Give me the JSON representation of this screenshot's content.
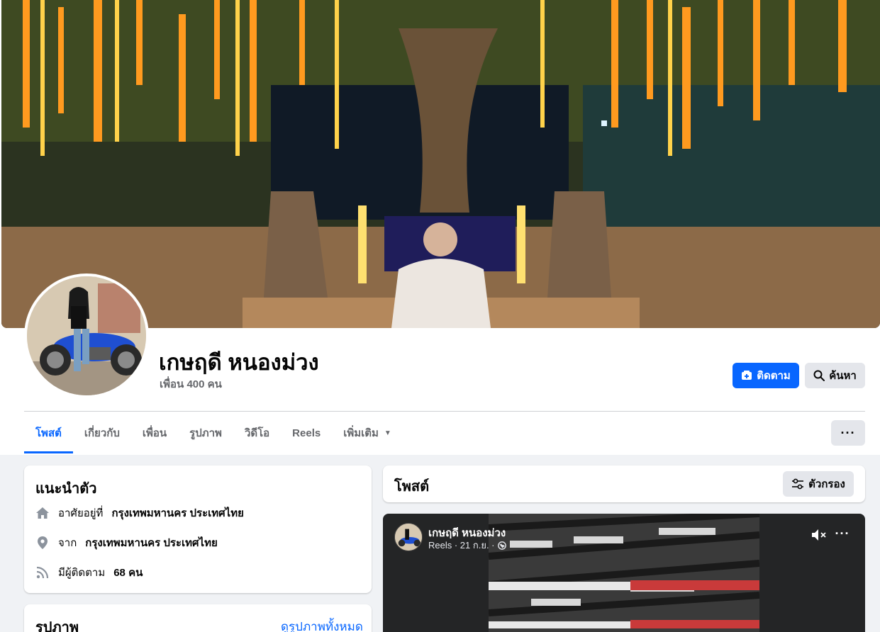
{
  "profile": {
    "name": "เกษฤดี หนองม่วง",
    "friends": "เพื่อน 400 คน"
  },
  "actions": {
    "follow_label": "ติดตาม",
    "search_label": "ค้นหา",
    "more_label": "···"
  },
  "tabs": [
    {
      "label": "โพสต์",
      "active": true
    },
    {
      "label": "เกี่ยวกับ",
      "active": false
    },
    {
      "label": "เพื่อน",
      "active": false
    },
    {
      "label": "รูปภาพ",
      "active": false
    },
    {
      "label": "วิดีโอ",
      "active": false
    },
    {
      "label": "Reels",
      "active": false
    },
    {
      "label": "เพิ่มเติม",
      "active": false
    }
  ],
  "intro": {
    "title": "แนะนำตัว",
    "lives_prefix": "อาศัยอยู่ที่",
    "lives_place": "กรุงเทพมหานคร ประเทศไทย",
    "from_prefix": "จาก",
    "from_place": "กรุงเทพมหานคร ประเทศไทย",
    "followers_prefix": "มีผู้ติดตาม",
    "followers_count": "68 คน"
  },
  "photos": {
    "title": "รูปภาพ",
    "see_all": "ดูรูปภาพทั้งหมด"
  },
  "posts": {
    "title": "โพสต์",
    "filter_label": "ตัวกรอง"
  },
  "reel": {
    "author": "เกษฤดี หนองม่วง",
    "meta": "Reels · 21 ก.ย. ·"
  },
  "colors": {
    "accent": "#0866ff",
    "background": "#f0f2f5",
    "secondary_button": "#e4e6eb",
    "muted_text": "#65676b"
  }
}
